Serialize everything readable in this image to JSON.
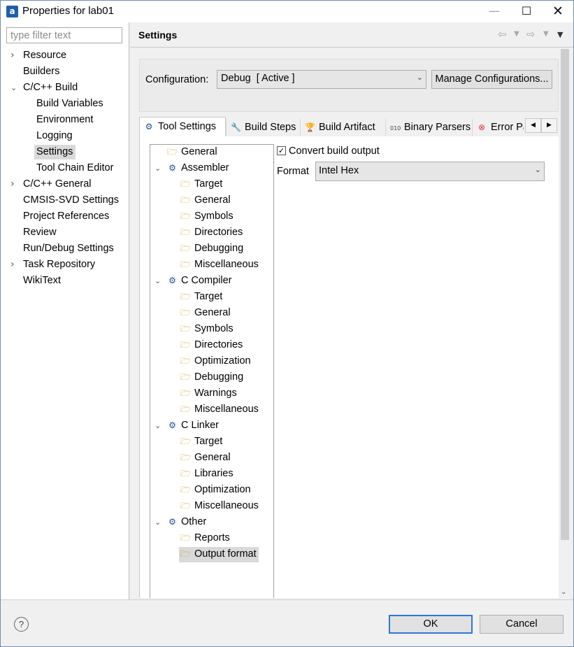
{
  "window": {
    "title": "Properties for lab01",
    "app_icon_glyph": "a"
  },
  "controls": {
    "minimize": "—",
    "maximize": "☐",
    "close": "✕"
  },
  "sidebar": {
    "filter_placeholder": "type filter text",
    "items": [
      {
        "label": "Resource",
        "expandable": true,
        "expanded": false
      },
      {
        "label": "Builders"
      },
      {
        "label": "C/C++ Build",
        "expandable": true,
        "expanded": true
      },
      {
        "label": "Build Variables"
      },
      {
        "label": "Environment"
      },
      {
        "label": "Logging"
      },
      {
        "label": "Settings",
        "selected": true
      },
      {
        "label": "Tool Chain Editor"
      },
      {
        "label": "C/C++ General",
        "expandable": true,
        "expanded": false
      },
      {
        "label": "CMSIS-SVD Settings"
      },
      {
        "label": "Project References"
      },
      {
        "label": "Review"
      },
      {
        "label": "Run/Debug Settings"
      },
      {
        "label": "Task Repository",
        "expandable": true,
        "expanded": false
      },
      {
        "label": "WikiText"
      }
    ]
  },
  "header": {
    "title": "Settings"
  },
  "configuration": {
    "label": "Configuration:",
    "value": "Debug  [ Active ]",
    "manage_label": "Manage Configurations..."
  },
  "tabs": [
    {
      "label": "Tool Settings",
      "icon": "gear-icon",
      "active": true
    },
    {
      "label": "Build Steps",
      "icon": "wrench-icon"
    },
    {
      "label": "Build Artifact",
      "icon": "trophy-icon"
    },
    {
      "label": "Binary Parsers",
      "icon": "binary-file-icon"
    },
    {
      "label": "Error Pa",
      "icon": "error-icon"
    }
  ],
  "tool_tree": [
    {
      "label": "General",
      "type": "folder"
    },
    {
      "label": "Assembler",
      "type": "tool"
    },
    {
      "label": "Target",
      "type": "folder"
    },
    {
      "label": "General",
      "type": "folder"
    },
    {
      "label": "Symbols",
      "type": "folder"
    },
    {
      "label": "Directories",
      "type": "folder"
    },
    {
      "label": "Debugging",
      "type": "folder"
    },
    {
      "label": "Miscellaneous",
      "type": "folder"
    },
    {
      "label": "C Compiler",
      "type": "tool"
    },
    {
      "label": "Target",
      "type": "folder"
    },
    {
      "label": "General",
      "type": "folder"
    },
    {
      "label": "Symbols",
      "type": "folder"
    },
    {
      "label": "Directories",
      "type": "folder"
    },
    {
      "label": "Optimization",
      "type": "folder"
    },
    {
      "label": "Debugging",
      "type": "folder"
    },
    {
      "label": "Warnings",
      "type": "folder"
    },
    {
      "label": "Miscellaneous",
      "type": "folder"
    },
    {
      "label": "C Linker",
      "type": "tool"
    },
    {
      "label": "Target",
      "type": "folder"
    },
    {
      "label": "General",
      "type": "folder"
    },
    {
      "label": "Libraries",
      "type": "folder"
    },
    {
      "label": "Optimization",
      "type": "folder"
    },
    {
      "label": "Miscellaneous",
      "type": "folder"
    },
    {
      "label": "Other",
      "type": "tool"
    },
    {
      "label": "Reports",
      "type": "folder"
    },
    {
      "label": "Output format",
      "type": "folder",
      "selected": true
    }
  ],
  "output": {
    "convert_label": "Convert build output",
    "convert_checked": true,
    "format_label": "Format",
    "format_value": "Intel Hex"
  },
  "buttons": {
    "ok": "OK",
    "cancel": "Cancel",
    "help": "?"
  }
}
